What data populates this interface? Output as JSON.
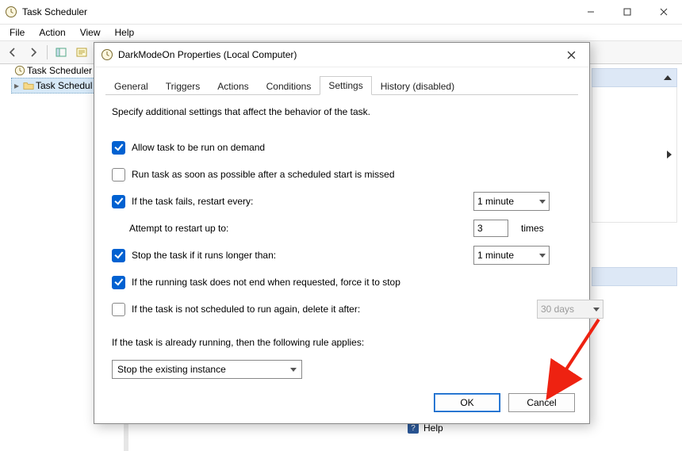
{
  "app": {
    "title": "Task Scheduler"
  },
  "menubar": {
    "file": "File",
    "action": "Action",
    "view": "View",
    "help": "Help"
  },
  "tree": {
    "root": "Task Scheduler (L",
    "child": "Task Schedul"
  },
  "bottom": {
    "help": "Help"
  },
  "dialog": {
    "title": "DarkModeOn Properties (Local Computer)",
    "tabs": {
      "general": "General",
      "triggers": "Triggers",
      "actions": "Actions",
      "conditions": "Conditions",
      "settings": "Settings",
      "history": "History (disabled)"
    },
    "settings": {
      "note": "Specify additional settings that affect the behavior of the task.",
      "allow_demand": "Allow task to be run on demand",
      "run_asap": "Run task as soon as possible after a scheduled start is missed",
      "restart_every": "If the task fails, restart every:",
      "restart_interval": "1 minute",
      "attempt_up_to": "Attempt to restart up to:",
      "attempt_count": "3",
      "attempt_times": "times",
      "stop_longer": "Stop the task if it runs longer than:",
      "stop_longer_val": "1 minute",
      "force_stop": "If the running task does not end when requested, force it to stop",
      "delete_after": "If the task is not scheduled to run again, delete it after:",
      "delete_after_val": "30 days",
      "rule_label": "If the task is already running, then the following rule applies:",
      "rule_value": "Stop the existing instance"
    },
    "buttons": {
      "ok": "OK",
      "cancel": "Cancel"
    }
  }
}
